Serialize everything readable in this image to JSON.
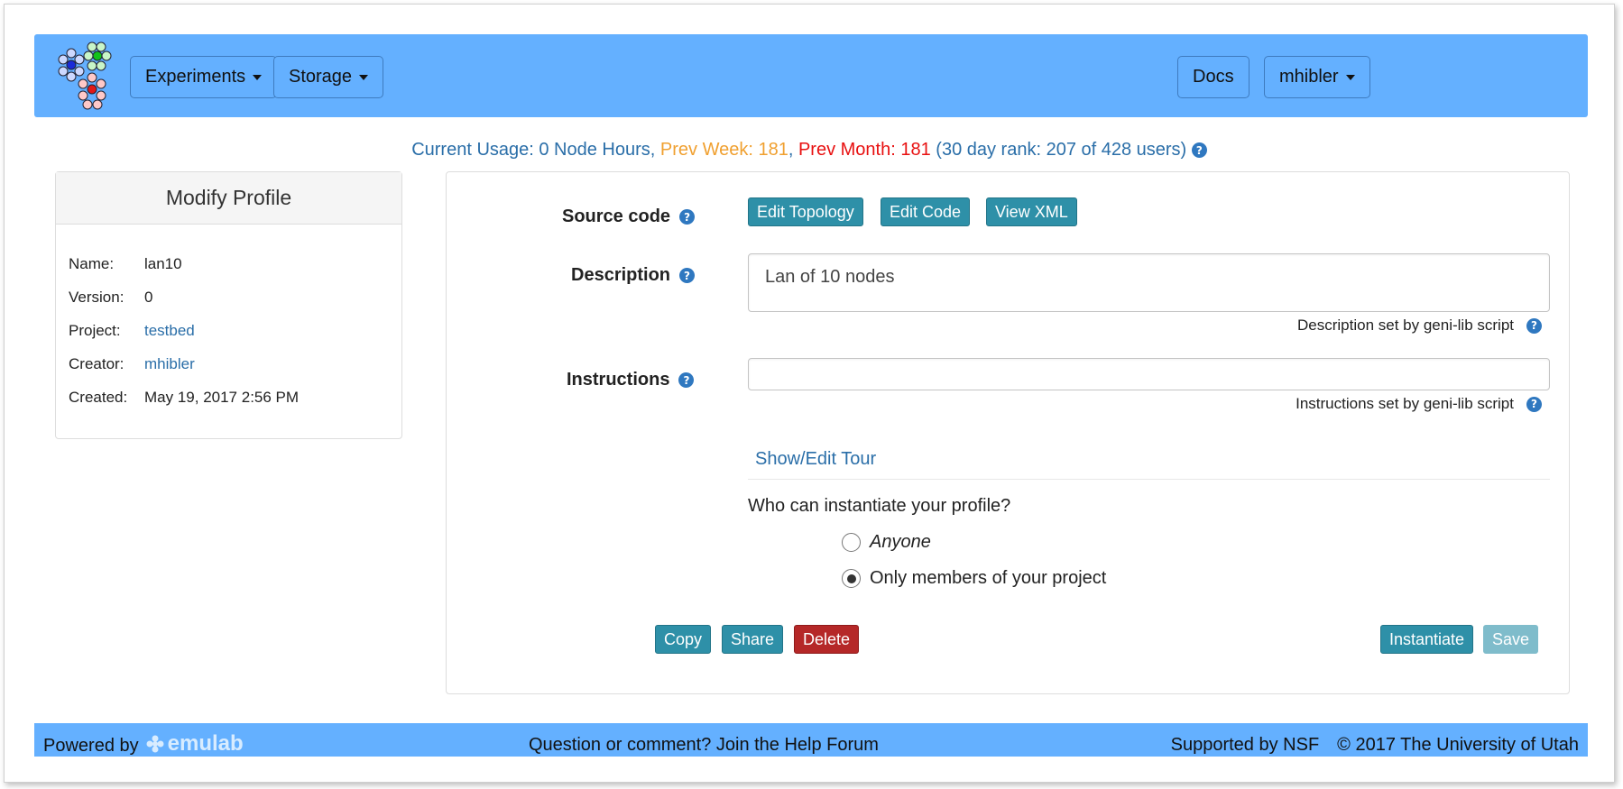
{
  "navbar": {
    "experiments_label": "Experiments",
    "storage_label": "Storage",
    "docs_label": "Docs",
    "user_label": "mhibler"
  },
  "usage": {
    "current": "Current Usage: 0 Node Hours",
    "prev_week": "Prev Week: 181",
    "prev_month": "Prev Month: 181",
    "rank": "(30 day rank: 207 of 428 users)"
  },
  "profile_card": {
    "title": "Modify Profile",
    "name_key": "Name:",
    "name_val": "lan10",
    "version_key": "Version:",
    "version_val": "0",
    "project_key": "Project:",
    "project_val": "testbed",
    "creator_key": "Creator:",
    "creator_val": "mhibler",
    "created_key": "Created:",
    "created_val": "May 19, 2017 2:56 PM"
  },
  "form": {
    "source_code_label": "Source code",
    "edit_topology": "Edit Topology",
    "edit_code": "Edit Code",
    "view_xml": "View XML",
    "description_label": "Description",
    "description_value": "Lan of 10 nodes",
    "description_hint": "Description set by geni-lib script",
    "instructions_label": "Instructions",
    "instructions_value": "",
    "instructions_hint": "Instructions set by geni-lib script",
    "tour_link": "Show/Edit Tour",
    "question": "Who can instantiate your profile?",
    "option_anyone": "Anyone",
    "option_project": "Only members of your project",
    "selected_option": "Only members of your project",
    "copy": "Copy",
    "share": "Share",
    "delete": "Delete",
    "instantiate": "Instantiate",
    "save": "Save"
  },
  "footer": {
    "powered_by": "Powered by",
    "emulab": "emulab",
    "help": "Question or comment? Join the Help Forum",
    "supported": "Supported by NSF",
    "copyright": "© 2017 The University of Utah"
  },
  "colors": {
    "navbar": "#64b0ff",
    "teal_button": "#2e90a8",
    "delete_button": "#b52828",
    "link": "#2a6ea8",
    "prev_week": "#f0a030",
    "prev_month": "#e81010"
  },
  "icons": [
    "emulab-logo-icon",
    "caret-down-icon",
    "help-icon",
    "radio-icon"
  ]
}
